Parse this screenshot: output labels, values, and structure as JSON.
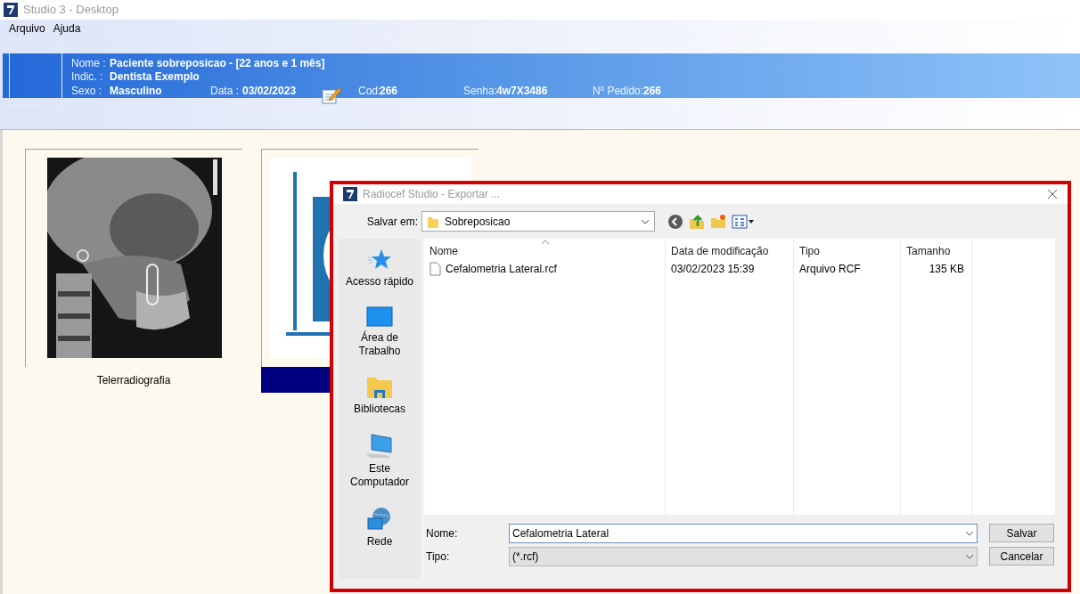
{
  "window": {
    "title": "Studio 3 - Desktop"
  },
  "menu": [
    "Arquivo",
    "Ajuda"
  ],
  "patient": {
    "rows": [
      [
        {
          "label": "Nome :",
          "value": "Paciente sobreposicao - [22 anos e 1 mês]"
        }
      ],
      [
        {
          "label": "Indic. :",
          "value": "Dentista Exemplo"
        }
      ],
      [
        {
          "label": "Sexo :",
          "value": "Masculino"
        },
        {
          "label": "Data :",
          "value": "03/02/2023"
        },
        {
          "label": "Cod:",
          "value": "266"
        },
        {
          "label": "Senha:",
          "value": "4w7X3486"
        },
        {
          "label": "Nº Pedido:",
          "value": "266"
        }
      ]
    ]
  },
  "thumbnails": [
    {
      "kind": "xray",
      "caption": "Telerradiografia",
      "selected": false
    },
    {
      "kind": "tracing",
      "selected": true
    }
  ],
  "dialog": {
    "title": "Radiocef Studio - Exportar ...",
    "save_in_label": "Salvar em:",
    "save_in": "Sobreposicao",
    "places": [
      {
        "kind": "star",
        "label": "Acesso rápido"
      },
      {
        "kind": "desktop",
        "label": "Área de Trabalho"
      },
      {
        "kind": "libraries",
        "label": "Bibliotecas"
      },
      {
        "kind": "computer",
        "label": "Este Computador"
      },
      {
        "kind": "network",
        "label": "Rede"
      }
    ],
    "columns": [
      "Nome",
      "Data de modificação",
      "Tipo",
      "Tamanho"
    ],
    "files": [
      {
        "name": "Cefalometria Lateral.rcf",
        "modified": "03/02/2023 15:39",
        "type": "Arquivo RCF",
        "size": "135 KB"
      }
    ],
    "file_name": {
      "label": "Nome:",
      "value": "Cefalometria Lateral"
    },
    "file_type": {
      "label": "Tipo:",
      "value": "(*.rcf)"
    },
    "buttons": [
      "Salvar",
      "Cancelar"
    ]
  }
}
